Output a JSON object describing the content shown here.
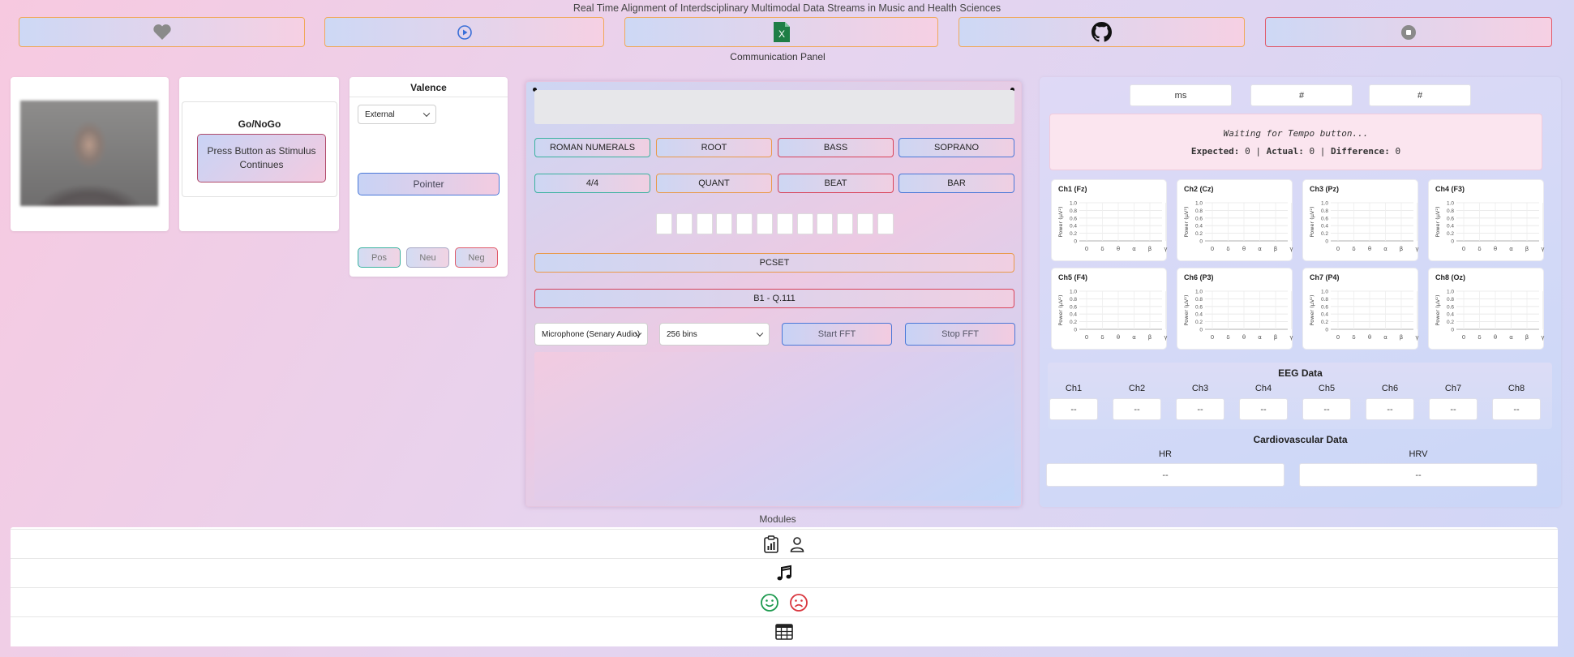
{
  "header": {
    "title": "Real Time Alignment of Interdsciplinary Multimodal Data Streams in Music and Health Sciences",
    "communication_panel": "Communication Panel",
    "icons": [
      "heart-icon",
      "play-icon",
      "excel-icon",
      "github-icon",
      "stop-icon"
    ],
    "excel_letter": "X"
  },
  "gonogo": {
    "title": "Go/NoGo",
    "button_label": "Press Button as Stimulus Continues"
  },
  "valence": {
    "title": "Valence",
    "source_selected": "External",
    "pointer_label": "Pointer",
    "pos_label": "Pos",
    "neu_label": "Neu",
    "neg_label": "Neg"
  },
  "theory": {
    "row1": [
      "ROMAN NUMERALS",
      "ROOT",
      "BASS",
      "SOPRANO"
    ],
    "row2": [
      "4/4",
      "QUANT",
      "BEAT",
      "BAR"
    ],
    "pcset_label": "PCSET",
    "score_label": "B1 - Q.111",
    "slot_count": 12,
    "audio_source": "Microphone (Senary Audio)",
    "bins": "256 bins",
    "start_fft": "Start FFT",
    "stop_fft": "Stop FFT"
  },
  "tempo": {
    "ms_value": "ms",
    "count_a": "#",
    "count_b": "#",
    "waiting_text": "Waiting for Tempo button...",
    "expected_label": "Expected:",
    "expected_value": "0",
    "actual_label": "Actual:",
    "actual_value": "0",
    "difference_label": "Difference:",
    "difference_value": "0",
    "separator": "|"
  },
  "channels": [
    {
      "name": "Ch1 (Fz)"
    },
    {
      "name": "Ch2 (Cz)"
    },
    {
      "name": "Ch3 (Pz)"
    },
    {
      "name": "Ch4 (F3)"
    },
    {
      "name": "Ch5 (F4)"
    },
    {
      "name": "Ch6 (P3)"
    },
    {
      "name": "Ch7 (P4)"
    },
    {
      "name": "Ch8 (Oz)"
    }
  ],
  "channel_chart": {
    "ylabel": "Power (µV²)",
    "yticks": [
      "1.0",
      "0.8",
      "0.6",
      "0.4",
      "0.2",
      "0"
    ],
    "xticks": [
      "δ",
      "θ",
      "α",
      "β",
      "γ"
    ],
    "x_origin": "0"
  },
  "eeg": {
    "title": "EEG Data",
    "labels": [
      "Ch1",
      "Ch2",
      "Ch3",
      "Ch4",
      "Ch5",
      "Ch6",
      "Ch7",
      "Ch8"
    ],
    "values": [
      "--",
      "--",
      "--",
      "--",
      "--",
      "--",
      "--",
      "--"
    ]
  },
  "cardio": {
    "title": "Cardiovascular Data",
    "hr_label": "HR",
    "hr_value": "--",
    "hrv_label": "HRV",
    "hrv_value": "--"
  },
  "modules": {
    "label": "Modules",
    "rows": [
      [
        "clipboard-chart-icon",
        "person-icon"
      ],
      [
        "music-note-icon"
      ],
      [
        "smile-icon",
        "frown-icon"
      ],
      [
        "table-icon"
      ]
    ]
  },
  "colors": {
    "accent_orange": "#f0a95a",
    "accent_red": "#e05a6a",
    "accent_blue": "#4a78d8",
    "accent_green": "#3bb2a0",
    "excel_green": "#1e7e45"
  }
}
